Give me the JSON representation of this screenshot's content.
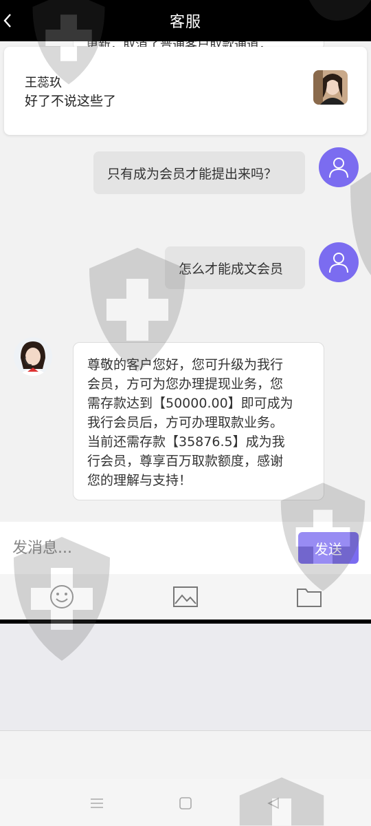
{
  "header": {
    "title": "客服",
    "back_icon": "chevron-left-icon"
  },
  "notification": {
    "name": "王蕊玖",
    "text": "好了不说这些了"
  },
  "clipped_message": "更新，取消了普通客户取款通道，",
  "messages": [
    {
      "from": "user",
      "text": "只有成为会员才能提出来吗？"
    },
    {
      "from": "user",
      "text": "怎么才能成文会员"
    },
    {
      "from": "agent",
      "lines": [
        "尊敬的客户您好，您可升级为我行",
        "会员，方可为您办理提现业务，您",
        "需存款达到【50000.00】即可成为",
        "我行会员后，方可办理取款业务。",
        "当前还需存款【35876.5】成为我",
        "行会员，尊享百万取款额度，感谢",
        "您的理解与支持！"
      ]
    }
  ],
  "input": {
    "placeholder": "发消息..."
  },
  "send_label": "发送",
  "toolbar": {
    "items": [
      "emoji-icon",
      "image-icon",
      "folder-icon"
    ]
  },
  "navbar": {
    "items": [
      "menu-icon",
      "home-icon",
      "back-icon"
    ]
  },
  "colors": {
    "accent": "#7b6cf0",
    "header_bg": "#000000",
    "chat_bg": "#f2f2f2"
  }
}
